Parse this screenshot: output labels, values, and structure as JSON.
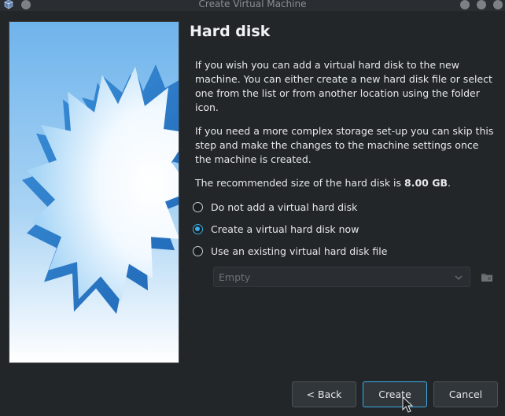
{
  "window": {
    "title": "Create Virtual Machine"
  },
  "page": {
    "heading": "Hard disk",
    "para1": "If you wish you can add a virtual hard disk to the new machine. You can either create a new hard disk file or select one from the list or from another location using the folder icon.",
    "para2": "If you need a more complex storage set-up you can skip this step and make the changes to the machine settings once the machine is created.",
    "recommended_prefix": "The recommended size of the hard disk is ",
    "recommended_size": "8.00 GB",
    "recommended_suffix": ".",
    "options": [
      {
        "label": "Do not add a virtual hard disk",
        "selected": false
      },
      {
        "label": "Create a virtual hard disk now",
        "selected": true
      },
      {
        "label": "Use an existing virtual hard disk file",
        "selected": false
      }
    ],
    "existing_disk_value": "Empty"
  },
  "buttons": {
    "back": "< Back",
    "create": "Create",
    "cancel": "Cancel"
  },
  "colors": {
    "accent": "#3daee9",
    "background": "#232629"
  },
  "icons": [
    "virtualbox-icon",
    "minimize-icon",
    "maximize-icon",
    "close-icon",
    "chevron-down-icon",
    "folder-icon",
    "mouse-cursor-icon"
  ]
}
